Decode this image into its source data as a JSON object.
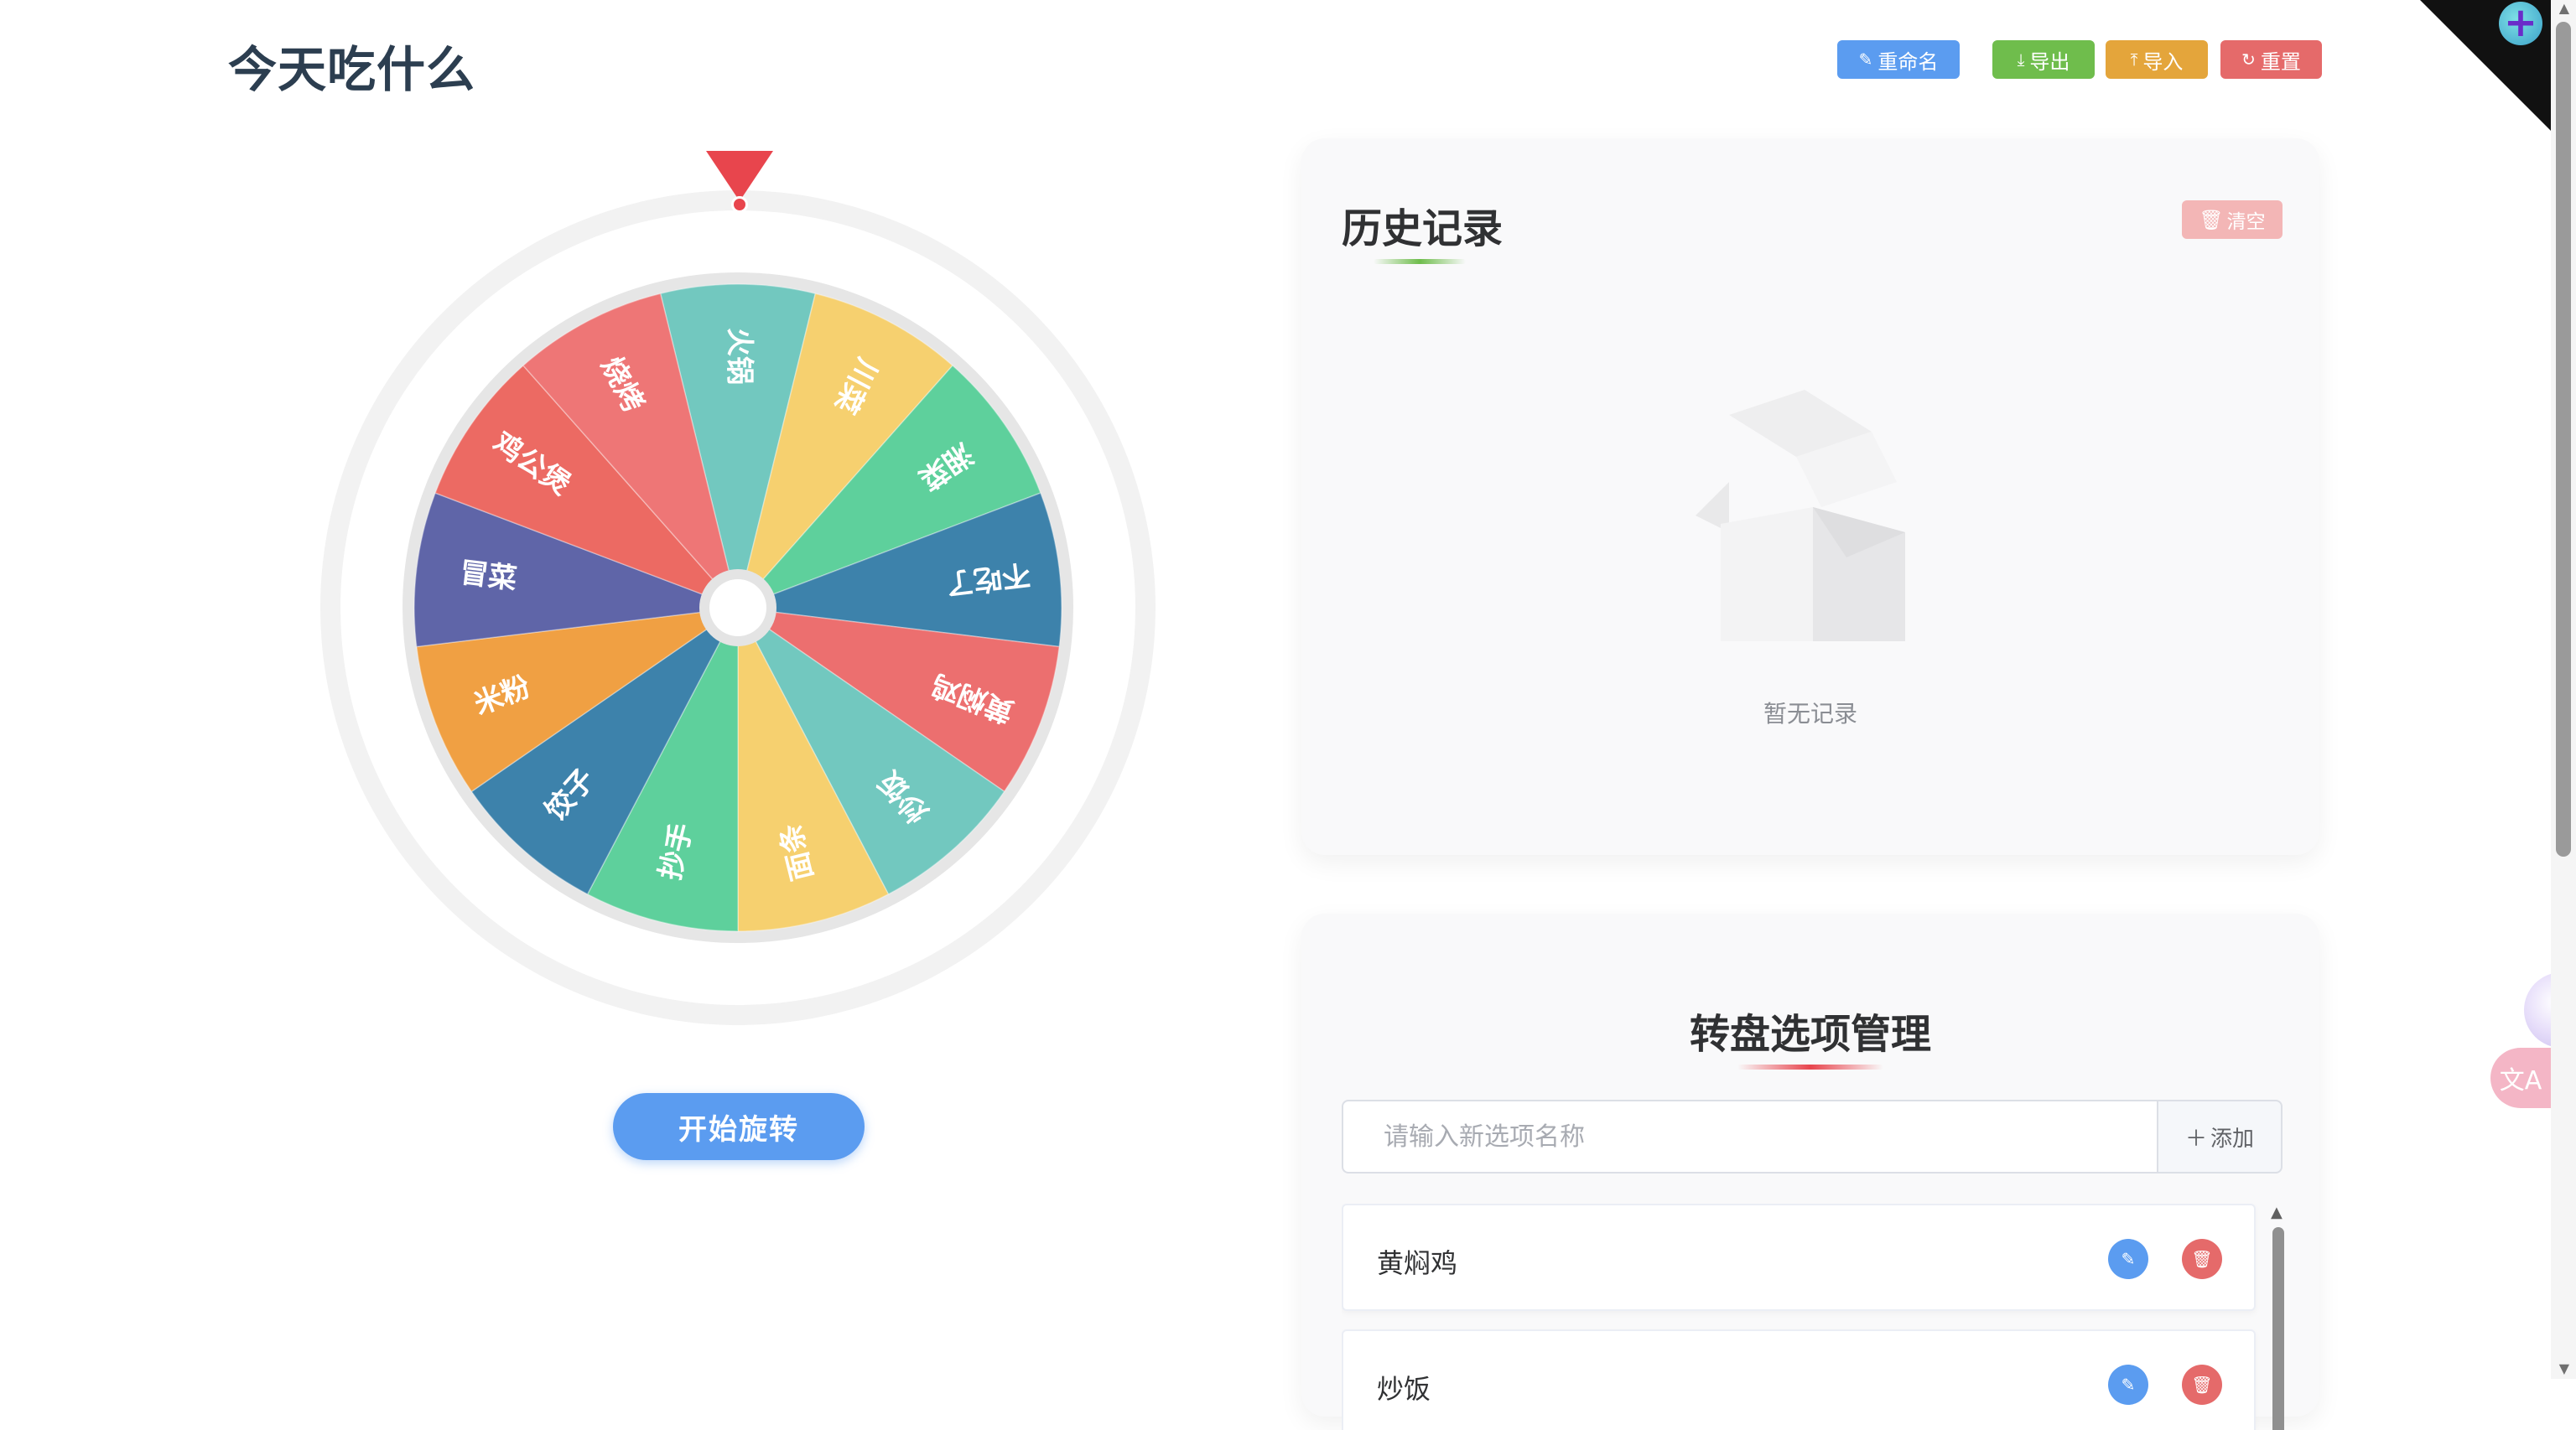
{
  "app": {
    "title": "今天吃什么"
  },
  "toolbar": {
    "rename_label": "重命名",
    "export_label": "导出",
    "import_label": "导入",
    "reset_label": "重置",
    "rename_icon": "edit-icon",
    "export_icon": "download-icon",
    "import_icon": "upload-icon",
    "reset_icon": "refresh-icon"
  },
  "wheel": {
    "spin_label": "开始旋转",
    "pointer_color": "#e8454d",
    "segments": [
      {
        "label": "火锅",
        "color": "#72c8bf"
      },
      {
        "label": "川菜",
        "color": "#f6d06f"
      },
      {
        "label": "湘菜",
        "color": "#5ed09c"
      },
      {
        "label": "不吃了",
        "color": "#3d82ab"
      },
      {
        "label": "黄焖鸡",
        "color": "#ec6f6f"
      },
      {
        "label": "炒饭",
        "color": "#72c8bf"
      },
      {
        "label": "面条",
        "color": "#f6d06f"
      },
      {
        "label": "抄手",
        "color": "#5ed09c"
      },
      {
        "label": "饺子",
        "color": "#3d82ab"
      },
      {
        "label": "米粉",
        "color": "#f0a043"
      },
      {
        "label": "冒菜",
        "color": "#5f65a8"
      },
      {
        "label": "鸡公煲",
        "color": "#ec6a63"
      },
      {
        "label": "烧烤",
        "color": "#ee7676"
      }
    ]
  },
  "history": {
    "title": "历史记录",
    "clear_label": "清空",
    "empty_text": "暂无记录"
  },
  "manage": {
    "title": "转盘选项管理",
    "input_placeholder": "请输入新选项名称",
    "input_value": "",
    "add_label": "添加",
    "options": [
      {
        "name": "黄焖鸡"
      },
      {
        "name": "炒饭"
      }
    ]
  },
  "colors": {
    "primary": "#5b9cf0",
    "success": "#6fbd4c",
    "warning": "#e4a53b",
    "danger": "#e56a6a"
  }
}
